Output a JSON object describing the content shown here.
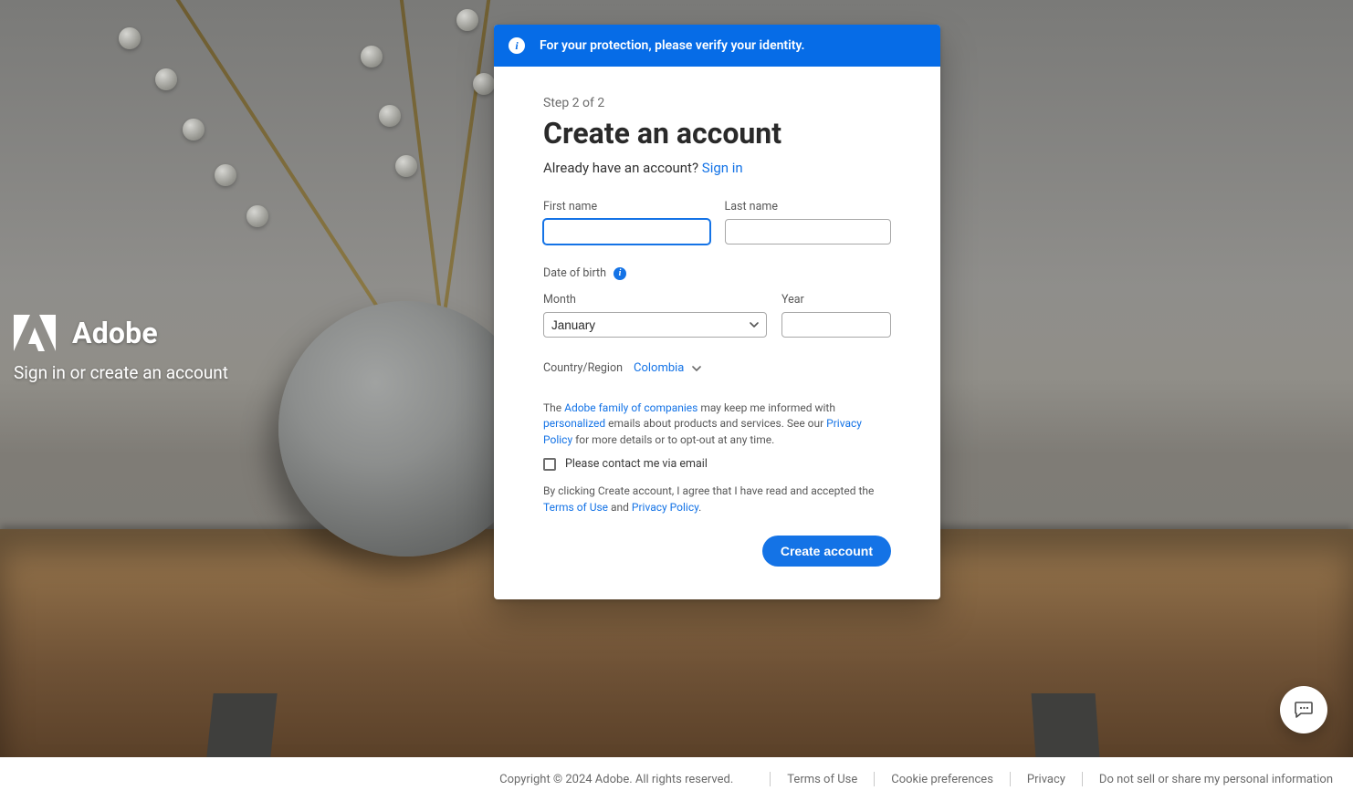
{
  "brand": {
    "name": "Adobe",
    "subtitle": "Sign in or create an account"
  },
  "banner": {
    "text": "For your protection, please verify your identity."
  },
  "form": {
    "step": "Step 2 of 2",
    "title": "Create an account",
    "already_q": "Already have an account? ",
    "signin": "Sign in",
    "first_name_label": "First name",
    "last_name_label": "Last name",
    "dob_label": "Date of birth",
    "month_label": "Month",
    "year_label": "Year",
    "month_value": "January",
    "country_label": "Country/Region",
    "country_value": "Colombia",
    "disclosure_pre": "The ",
    "disclosure_family_link": "Adobe family of companies",
    "disclosure_mid1": " may keep me informed with ",
    "disclosure_personalized_link": "personalized",
    "disclosure_mid2": " emails about products and services. See our ",
    "disclosure_privacy_link": "Privacy Policy",
    "disclosure_post": " for more details or to opt-out at any time.",
    "checkbox_label": "Please contact me via email",
    "agree_pre": "By clicking Create account, I agree that I have read and accepted the ",
    "agree_tou": "Terms of Use",
    "agree_mid": " and ",
    "agree_pp": "Privacy Policy",
    "agree_post": ".",
    "submit_label": "Create account"
  },
  "footer": {
    "copyright": "Copyright © 2024 Adobe. All rights reserved.",
    "links": {
      "terms": "Terms of Use",
      "cookies": "Cookie preferences",
      "privacy": "Privacy",
      "dns": "Do not sell or share my personal information"
    }
  }
}
